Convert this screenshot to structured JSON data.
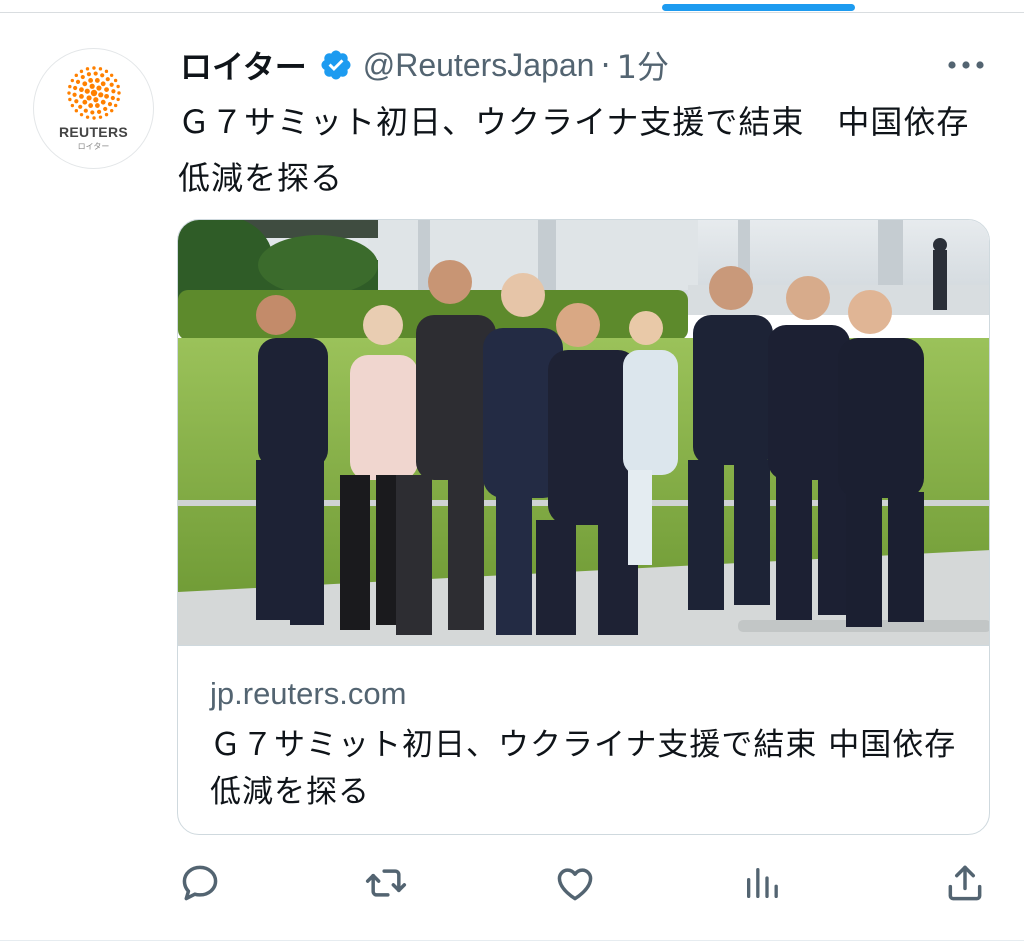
{
  "tweet": {
    "author": {
      "display_name": "ロイター",
      "handle": "@ReutersJapan",
      "avatar_brand": "REUTERS",
      "avatar_brand_sub": "ロイター",
      "verified": true
    },
    "separator": "·",
    "time": "1分",
    "text": "Ｇ７サミット初日、ウクライナ支援で結束　中国依存低減を探る",
    "card": {
      "domain": "jp.reuters.com",
      "title": "Ｇ７サミット初日、ウクライナ支援で結束 中国依存低減を探る"
    },
    "actions": [
      {
        "name": "reply",
        "icon": "reply-icon"
      },
      {
        "name": "retweet",
        "icon": "retweet-icon"
      },
      {
        "name": "like",
        "icon": "heart-icon"
      },
      {
        "name": "views",
        "icon": "analytics-icon"
      },
      {
        "name": "share",
        "icon": "share-icon"
      }
    ]
  },
  "colors": {
    "accent": "#1d9bf0",
    "text": "#0f1419",
    "secondary": "#536471",
    "reuters_orange": "#ff8000"
  }
}
